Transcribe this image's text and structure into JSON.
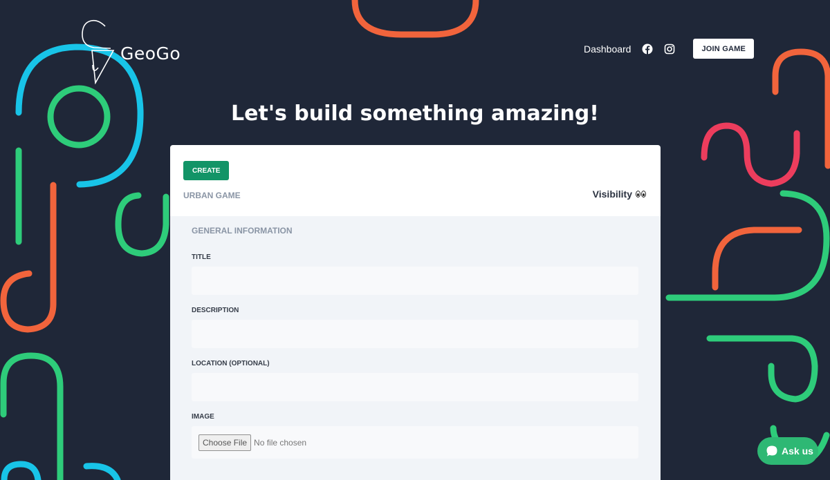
{
  "brand": {
    "name": "GeoGo"
  },
  "nav": {
    "dashboard": "Dashboard",
    "facebook_icon": "facebook-icon",
    "instagram_icon": "instagram-icon",
    "join_game": "JOIN GAME"
  },
  "headline": "Let's build something amazing!",
  "card": {
    "create_label": "CREATE",
    "game_type": "URBAN GAME",
    "visibility_label": "Visibility",
    "visibility_icon": "eyes-icon",
    "section_title": "GENERAL INFORMATION",
    "fields": {
      "title_label": "TITLE",
      "title_value": "",
      "description_label": "DESCRIPTION",
      "description_value": "",
      "location_label": "LOCATION (OPTIONAL)",
      "location_value": "",
      "image_label": "IMAGE",
      "file_button": "Choose File",
      "file_status": "No file chosen"
    }
  },
  "chat": {
    "label": "Ask us",
    "icon": "chat-bubble-icon"
  },
  "colors": {
    "background": "#1f2738",
    "accent_green": "#129467",
    "deco_orange": "#f1643c",
    "deco_green": "#2ecc7a",
    "deco_blue": "#18c4e8",
    "deco_pink": "#ec3d5d"
  }
}
